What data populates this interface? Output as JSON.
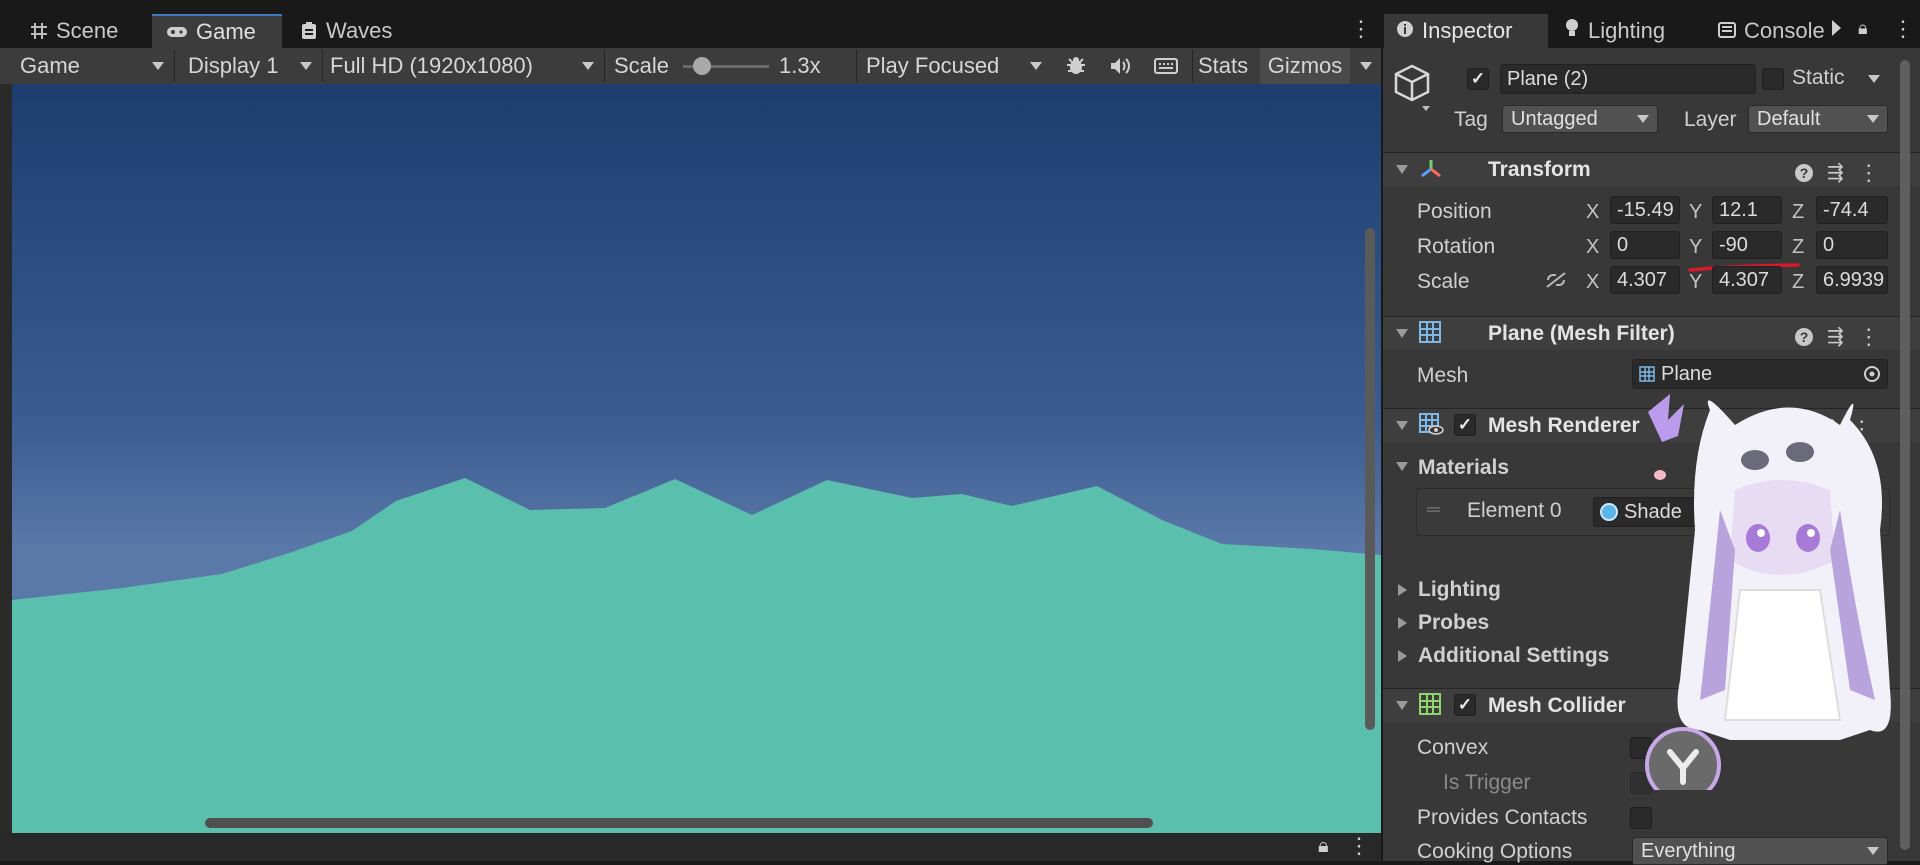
{
  "scene_tabs": {
    "scene": "Scene",
    "game": "Game",
    "waves": "Waves"
  },
  "game_toolbar": {
    "view": "Game",
    "display": "Display 1",
    "resolution": "Full HD (1920x1080)",
    "scale_label": "Scale",
    "scale_value": "1.3x",
    "play_mode": "Play Focused",
    "stats": "Stats",
    "gizmos": "Gizmos"
  },
  "inspector_tabs": {
    "inspector": "Inspector",
    "lighting": "Lighting",
    "console": "Console"
  },
  "object": {
    "name": "Plane (2)",
    "static_label": "Static",
    "tag_label": "Tag",
    "tag_value": "Untagged",
    "layer_label": "Layer",
    "layer_value": "Default"
  },
  "transform": {
    "title": "Transform",
    "position_label": "Position",
    "rotation_label": "Rotation",
    "scale_label": "Scale",
    "axis_x": "X",
    "axis_y": "Y",
    "axis_z": "Z",
    "position": {
      "x": "-15.49",
      "y": "12.1",
      "z": "-74.4"
    },
    "rotation": {
      "x": "0",
      "y": "-90",
      "z": "0"
    },
    "scale": {
      "x": "4.307",
      "y": "4.307",
      "z": "6.9939"
    }
  },
  "mesh_filter": {
    "title": "Plane (Mesh Filter)",
    "mesh_label": "Mesh",
    "mesh_value": "Plane"
  },
  "mesh_renderer": {
    "title": "Mesh Renderer",
    "materials_label": "Materials",
    "element_label": "Element 0",
    "element_value": "Shade",
    "lighting": "Lighting",
    "probes": "Probes",
    "additional": "Additional Settings"
  },
  "mesh_collider": {
    "title": "Mesh Collider",
    "convex": "Convex",
    "is_trigger": "Is Trigger",
    "provides_contacts": "Provides Contacts",
    "cooking_label": "Cooking Options",
    "cooking_value": "Everything"
  },
  "colors": {
    "sky_top": "#1d3d6e",
    "sky_horizon": "#5a78a8",
    "terrain": "#5bbfad",
    "accent_annotation": "#d8192c"
  }
}
